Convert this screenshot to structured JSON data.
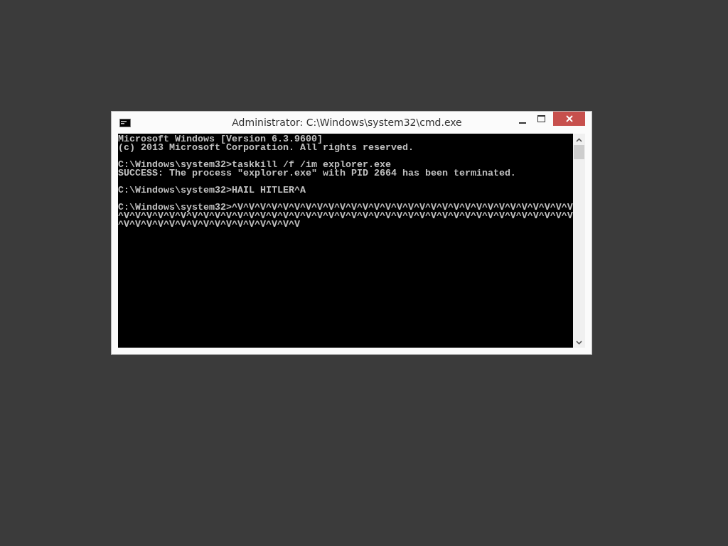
{
  "window": {
    "title": "Administrator: C:\\Windows\\system32\\cmd.exe"
  },
  "console": {
    "blocks": [
      [
        "Microsoft Windows [Version 6.3.9600]",
        "(c) 2013 Microsoft Corporation. All rights reserved."
      ],
      [
        "C:\\Windows\\system32>taskkill /f /im explorer.exe",
        "SUCCESS: The process \"explorer.exe\" with PID 2664 has been terminated."
      ],
      [
        "C:\\Windows\\system32>HAIL HITLER^A"
      ],
      [
        "C:\\Windows\\system32>^V^V^V^V^V^V^V^V^V^V^V^V^V^V^V^V^V^V^V^V^V^V^V^V^V^V^V^V^V^V",
        "^V^V^V^V^V^V^V^V^V^V^V^V^V^V^V^V^V^V^V^V^V^V^V^V^V^V^V^V^V^V^V^V^V^V^V^V^V^V^V^V",
        "^V^V^V^V^V^V^V^V^V^V^V^V^V^V^V^V"
      ]
    ]
  }
}
